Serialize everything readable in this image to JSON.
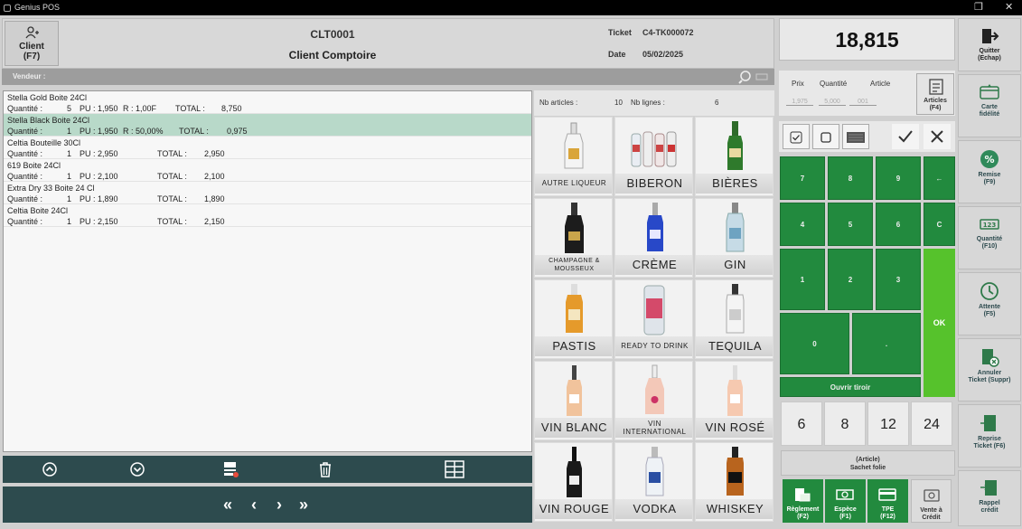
{
  "window": {
    "title": "Genius POS"
  },
  "header": {
    "client_button": "Client\n(F7)",
    "client_code": "CLT0001",
    "client_name": "Client Comptoire",
    "ticket_label": "Ticket",
    "ticket_value": "C4-TK000072",
    "date_label": "Date",
    "date_value": "05/02/2025",
    "vendeur_label": "Vendeur :"
  },
  "ticket_lines": [
    {
      "name": "Stella Gold Boite 24Cl",
      "qty_label": "Quantité :",
      "qty": "5",
      "pu": "PU : 1,950",
      "extra": "R :  1,00F",
      "total_label": "TOTAL :",
      "total": "8,750"
    },
    {
      "name": "Stella Black Boite 24Cl",
      "qty_label": "Quantité :",
      "qty": "1",
      "pu": "PU : 1,950",
      "extra": "R : 50,00%",
      "total_label": "TOTAL :",
      "total": "0,975"
    },
    {
      "name": "Celtia Bouteille 30Cl",
      "qty_label": "Quantité :",
      "qty": "1",
      "pu": "PU : 2,950",
      "extra": "",
      "total_label": "TOTAL :",
      "total": "2,950"
    },
    {
      "name": "619 Boite 24Cl",
      "qty_label": "Quantité :",
      "qty": "1",
      "pu": "PU : 2,100",
      "extra": "",
      "total_label": "TOTAL :",
      "total": "2,100"
    },
    {
      "name": "Extra Dry 33 Boite 24 Cl",
      "qty_label": "Quantité :",
      "qty": "1",
      "pu": "PU : 1,890",
      "extra": "",
      "total_label": "TOTAL :",
      "total": "1,890"
    },
    {
      "name": "Celtia Boite 24Cl",
      "qty_label": "Quantité :",
      "qty": "1",
      "pu": "PU : 2,150",
      "extra": "",
      "total_label": "TOTAL :",
      "total": "2,150"
    }
  ],
  "counts": {
    "articles_label": "Nb articles :",
    "articles": "10",
    "lines_label": "Nb lignes :",
    "lines": "6"
  },
  "nav": {
    "first": "«",
    "prev": "‹",
    "next": "›",
    "last": "»"
  },
  "categories": [
    "AUTRE LIQUEUR",
    "BIBERON",
    "BIÈRES",
    "CHAMPAGNE &\nMOUSSEUX",
    "CRÈME",
    "GIN",
    "PASTIS",
    "READY TO DRINK",
    "TEQUILA",
    "VIN BLANC",
    "VIN\nINTERNATIONAL",
    "VIN ROSÉ",
    "VIN ROUGE",
    "VODKA",
    "WHISKEY"
  ],
  "total": "18,815",
  "entry": {
    "prix": "Prix",
    "quantite": "Quantité",
    "article": "Article",
    "prix_val": "1,975",
    "quantite_val": "5,000",
    "article_val": "001"
  },
  "articles_button": "Articles\n(F4)",
  "keypad": {
    "k7": "7",
    "k8": "8",
    "k9": "9",
    "back": "←",
    "k4": "4",
    "k5": "5",
    "k6": "6",
    "clear": "C",
    "k1": "1",
    "k2": "2",
    "k3": "3",
    "k0": "0",
    "dot": ".",
    "ok": "OK",
    "drawer": "Ouvrir tiroir"
  },
  "quick_qty": [
    "6",
    "8",
    "12",
    "24"
  ],
  "sachet": "(Article)\nSachet folie",
  "payments": {
    "reglement": "Règlement\n(F2)",
    "espece": "Espèce\n(F1)",
    "tpe": "TPE\n(F12)",
    "vente_credit": "Vente à\nCrédit"
  },
  "sidebar": {
    "quitter": "Quitter\n(Echap)",
    "carte": "Carte\nfidélité",
    "remise": "Remise\n(F9)",
    "quantite": "Quantité\n(F10)",
    "attente": "Attente\n(F5)",
    "annuler": "Annuler\nTicket (Suppr)",
    "reprise": "Reprise\nTicket (F6)",
    "rappel": "Rappel\ncrédit"
  },
  "colors": {
    "green": "#228a3e",
    "ok_green": "#56c22c",
    "dark_teal": "#2d4b4e",
    "selected_row": "#b8d9c9"
  }
}
